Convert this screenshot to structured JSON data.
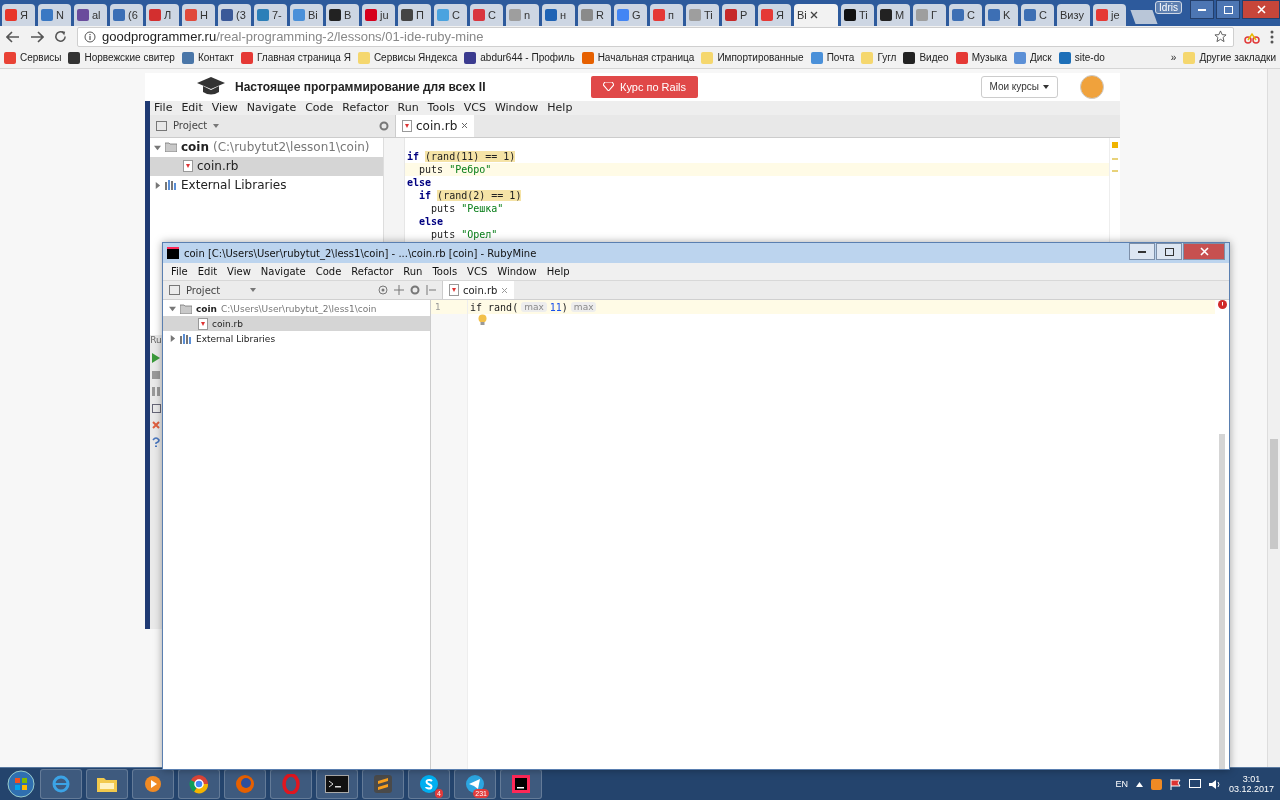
{
  "browser": {
    "tabs": [
      {
        "label": "Я",
        "color": "#e8362a",
        "selected": false
      },
      {
        "label": "N",
        "color": "#3a78c3",
        "selected": false
      },
      {
        "label": "al",
        "color": "#6a4c9c",
        "selected": false
      },
      {
        "label": "(6",
        "color": "#3b6fb6",
        "selected": false
      },
      {
        "label": "Л",
        "color": "#d32f2f",
        "selected": false
      },
      {
        "label": "Н",
        "color": "#e04a3c",
        "selected": false
      },
      {
        "label": "(3",
        "color": "#3b5998",
        "selected": false
      },
      {
        "label": "7-",
        "color": "#2c7fb8",
        "selected": false
      },
      {
        "label": "Ві",
        "color": "#4a90d9",
        "selected": false
      },
      {
        "label": "В",
        "color": "#222222",
        "selected": false
      },
      {
        "label": "ju",
        "color": "#d6001c",
        "selected": false
      },
      {
        "label": "П",
        "color": "#444444",
        "selected": false
      },
      {
        "label": "С",
        "color": "#4aa3df",
        "selected": false
      },
      {
        "label": "С",
        "color": "#d9363e",
        "selected": false
      },
      {
        "label": "n",
        "color": "#9e9e9e",
        "selected": false
      },
      {
        "label": "н",
        "color": "#1f63b5",
        "selected": false
      },
      {
        "label": "R",
        "color": "#8a8a8a",
        "selected": false
      },
      {
        "label": "G",
        "color": "#4285f4",
        "selected": false
      },
      {
        "label": "п",
        "color": "#e53935",
        "selected": false
      },
      {
        "label": "Ti",
        "color": "#9e9e9e",
        "selected": false
      },
      {
        "label": "P",
        "color": "#c62828",
        "selected": false
      },
      {
        "label": "Я",
        "color": "#e53935",
        "selected": false
      },
      {
        "label": "Ві",
        "selected": true
      },
      {
        "label": "Ti",
        "color": "#111111",
        "selected": false
      },
      {
        "label": "M",
        "color": "#222222",
        "selected": false
      },
      {
        "label": "Г",
        "color": "#9e9e9e",
        "selected": false
      },
      {
        "label": "С",
        "color": "#3d6fb4",
        "selected": false
      },
      {
        "label": "K",
        "color": "#3d6fb4",
        "selected": false
      },
      {
        "label": "С",
        "color": "#3d6fb4",
        "selected": false
      },
      {
        "label": "Визу",
        "selected": false
      },
      {
        "label": "je",
        "color": "#e53935",
        "selected": false
      }
    ],
    "profile": "Idris",
    "address": {
      "host": "goodprogrammer.ru",
      "path": "/real-programming-2/lessons/01-ide-ruby-mine"
    },
    "bookmarks": [
      {
        "label": "Сервисы",
        "color": "#e94235"
      },
      {
        "label": "Норвежские свитер",
        "color": "#333333"
      },
      {
        "label": "Контакт",
        "color": "#4a76a8"
      },
      {
        "label": "Главная страница Я",
        "color": "#e53935"
      },
      {
        "label": "Сервисы Яндекса",
        "color": "#f5d76e"
      },
      {
        "label": "abdur644 - Профиль",
        "color": "#3b3b8f"
      },
      {
        "label": "Начальная страница",
        "color": "#e66000"
      },
      {
        "label": "Импортированные",
        "color": "#f5d76e"
      },
      {
        "label": "Почта",
        "color": "#4a90d9"
      },
      {
        "label": "Гугл",
        "color": "#f5d76e"
      },
      {
        "label": "Видео",
        "color": "#222222"
      },
      {
        "label": "Музыка",
        "color": "#e53935"
      },
      {
        "label": "Диск",
        "color": "#5b8fd6"
      },
      {
        "label": "site-do",
        "color": "#1d6fb8"
      }
    ],
    "more": "»",
    "other_bookmarks": "Другие закладки"
  },
  "site": {
    "title": "Настоящее программирование для всех II",
    "cta": "Курс по Rails",
    "menu": "Мои курсы"
  },
  "video_ide": {
    "menu": [
      "File",
      "Edit",
      "View",
      "Navigate",
      "Code",
      "Refactor",
      "Run",
      "Tools",
      "VCS",
      "Window",
      "Help"
    ],
    "project_label": "Project",
    "tree": [
      {
        "label": "coin",
        "path": "(C:\\rubytut2\\lesson1\\coin)",
        "expanded": true,
        "selected": false,
        "children": [
          {
            "label": "coin.rb",
            "selected": true
          }
        ]
      },
      {
        "label": "External Libraries",
        "expanded": false,
        "selected": false
      }
    ],
    "tab": "coin.rb",
    "code": [
      {
        "current": false,
        "segments": [
          {
            "text": "if ",
            "kind": "keyword"
          },
          {
            "text": "(rand(11) == 1)",
            "kind": "match"
          }
        ]
      },
      {
        "current": true,
        "segments": [
          {
            "text": "  puts ",
            "kind": "plain"
          },
          {
            "text": "\"Ребро\"",
            "kind": "string"
          }
        ]
      },
      {
        "current": false,
        "segments": [
          {
            "text": "else",
            "kind": "keyword"
          }
        ]
      },
      {
        "current": false,
        "segments": [
          {
            "text": "  if ",
            "kind": "keyword"
          },
          {
            "text": "(rand(2) == 1)",
            "kind": "match"
          }
        ]
      },
      {
        "current": false,
        "segments": [
          {
            "text": "    puts ",
            "kind": "plain"
          },
          {
            "text": "\"Решка\"",
            "kind": "string"
          }
        ]
      },
      {
        "current": false,
        "segments": [
          {
            "text": "  else",
            "kind": "keyword"
          }
        ]
      },
      {
        "current": false,
        "segments": [
          {
            "text": "    puts ",
            "kind": "plain"
          },
          {
            "text": "\"Орел\"",
            "kind": "string"
          }
        ]
      }
    ],
    "run_label": "Ru"
  },
  "rubymine": {
    "title": "coin [C:\\Users\\User\\rubytut_2\\less1\\coin] - ...\\coin.rb [coin] - RubyMine",
    "menu": [
      "File",
      "Edit",
      "View",
      "Navigate",
      "Code",
      "Refactor",
      "Run",
      "Tools",
      "VCS",
      "Window",
      "Help"
    ],
    "project_label": "Project",
    "tree": [
      {
        "label": "coin",
        "path": "C:\\Users\\User\\rubytut_2\\less1\\coin",
        "expanded": true,
        "selected": false,
        "children": [
          {
            "label": "coin.rb",
            "selected": true
          }
        ]
      },
      {
        "label": "External Libraries",
        "expanded": false,
        "selected": false
      }
    ],
    "tab": "coin.rb",
    "lines": [
      {
        "number": "1",
        "current": true,
        "segments": [
          {
            "text": "if rand(",
            "kind": "plain"
          },
          {
            "text": "max",
            "kind": "hint"
          },
          {
            "text": "11",
            "kind": "number"
          },
          {
            "text": ")",
            "kind": "plain"
          },
          {
            "text": "max",
            "kind": "hint"
          }
        ]
      }
    ]
  },
  "taskbar": {
    "apps": [
      {
        "kind": "ie"
      },
      {
        "kind": "explorer"
      },
      {
        "kind": "media"
      },
      {
        "kind": "chrome"
      },
      {
        "kind": "firefox"
      },
      {
        "kind": "opera"
      },
      {
        "kind": "terminal"
      },
      {
        "kind": "sublime"
      },
      {
        "kind": "skype",
        "badge": "4"
      },
      {
        "kind": "telegram",
        "badge": "231"
      },
      {
        "kind": "rubymine"
      }
    ],
    "language": "EN",
    "time": "3:01",
    "date": "03.12.2017"
  }
}
